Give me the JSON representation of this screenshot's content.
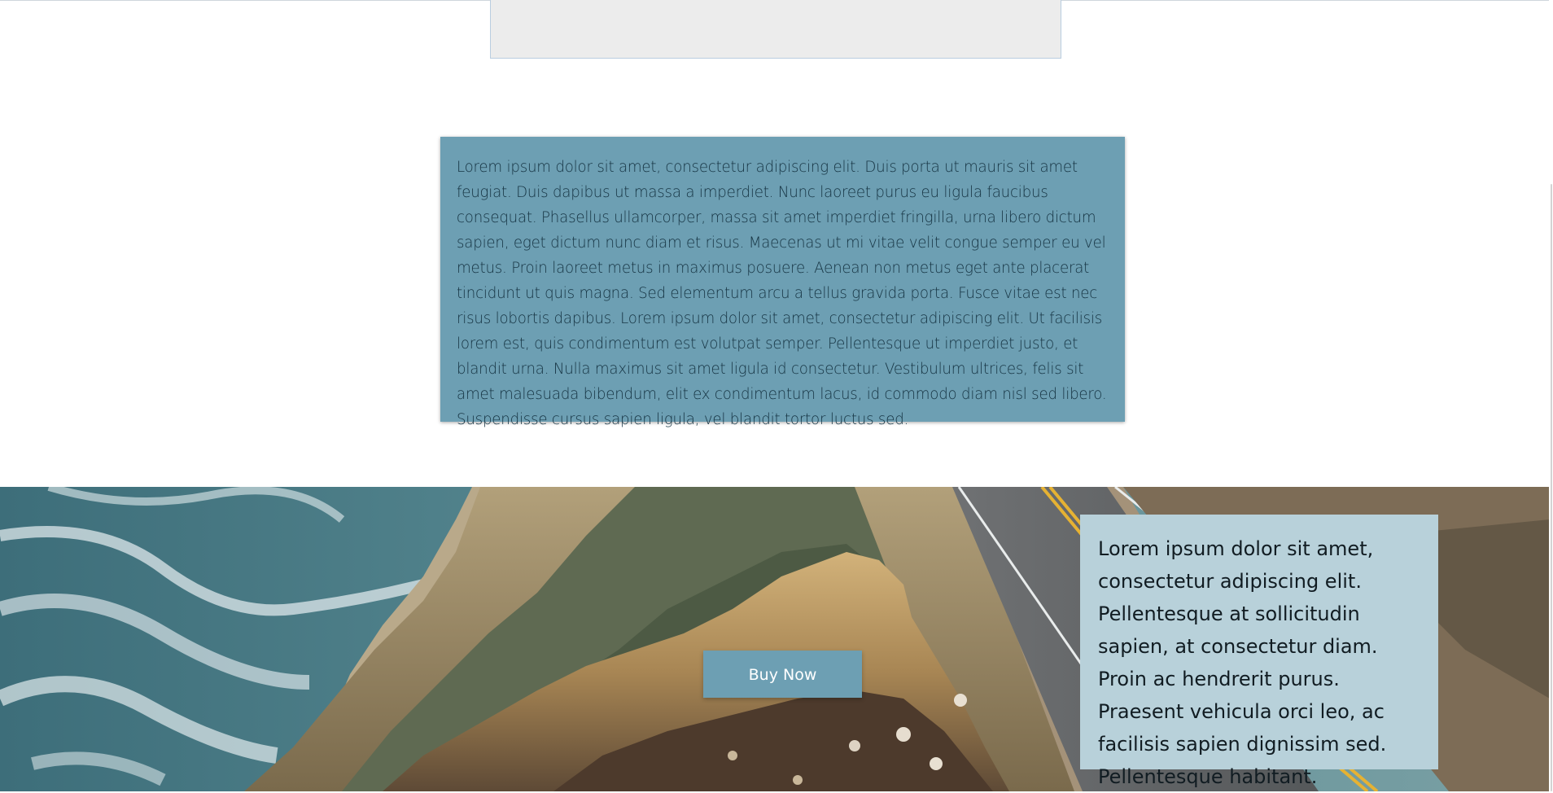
{
  "placeholder": {},
  "text_panel": {
    "body": "Lorem ipsum dolor sit amet, consectetur adipiscing elit. Duis porta ut mauris sit amet feugiat. Duis dapibus ut massa a imperdiet. Nunc laoreet purus eu ligula faucibus consequat. Phasellus ullamcorper, massa sit amet imperdiet fringilla, urna libero dictum sapien, eget dictum nunc diam et risus. Maecenas ut mi vitae velit congue semper eu vel metus. Proin laoreet metus in maximus posuere. Aenean non metus eget ante placerat tincidunt ut quis magna. Sed elementum arcu a tellus gravida porta. Fusce vitae est nec risus lobortis dapibus. Lorem ipsum dolor sit amet, consectetur adipiscing elit. Ut facilisis lorem est, quis condimentum est volutpat semper. Pellentesque ut imperdiet justo, et blandit urna. Nulla maximus sit amet ligula id consectetur. Vestibulum ultrices, felis sit amet malesuada bibendum, elit ex condimentum lacus, id commodo diam nisl sed libero. Suspendisse cursus sapien ligula, vel blandit tortor luctus sed."
  },
  "hero": {
    "button_label": "Buy Now",
    "card_text": "Lorem ipsum dolor sit amet, consectetur adipiscing elit. Pellentesque at sollicitudin sapien, at consectetur diam. Proin ac hendrerit purus. Praesent vehicula orci leo, ac facilisis sapien dignissim sed. Pellentesque habitant."
  },
  "colors": {
    "panel_bg": "#6d9fb3",
    "card_bg": "#b8d1da",
    "button_bg": "#6d9fb3",
    "button_text": "#ffffff"
  }
}
